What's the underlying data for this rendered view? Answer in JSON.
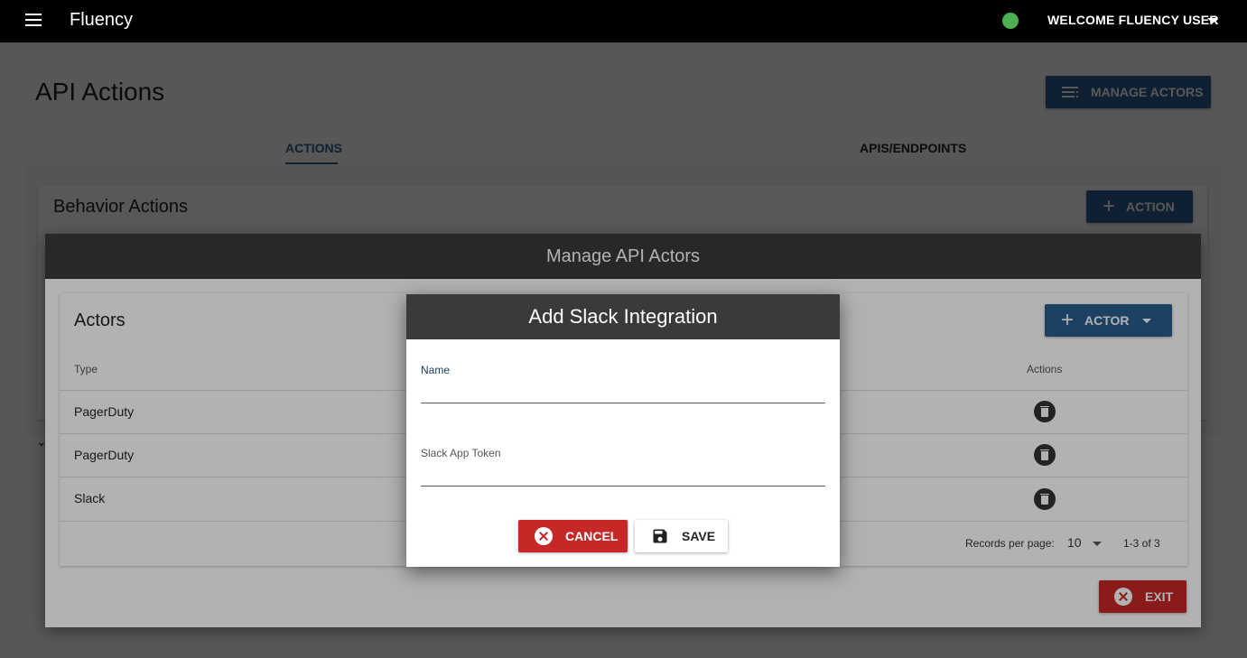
{
  "app": {
    "title": "Fluency",
    "user_menu": "WELCOME FLUENCY USER"
  },
  "icons": {
    "menu": "hamburger-icon",
    "status": "status-dot-icon",
    "manage_actors": "list-icon",
    "add": "plus-icon",
    "delete": "trash-icon",
    "cancel": "close-circle-icon",
    "save": "save-icon"
  },
  "colors": {
    "primary": "#2a5d8f",
    "danger": "#c62828",
    "status": "#4caf50",
    "header": "#3a3a3a"
  },
  "page": {
    "title": "API Actions",
    "manage_actors_label": "MANAGE ACTORS",
    "tabs": [
      {
        "label": "ACTIONS",
        "active": true
      },
      {
        "label": "APIS/ENDPOINTS",
        "active": false
      }
    ],
    "card_title": "Behavior Actions",
    "action_label": "ACTION"
  },
  "manage_dialog": {
    "title": "Manage API Actors",
    "card_title": "Actors",
    "actor_label": "ACTOR",
    "columns": {
      "type": "Type",
      "actions": "Actions"
    },
    "rows": [
      {
        "type": "PagerDuty"
      },
      {
        "type": "PagerDuty"
      },
      {
        "type": "Slack"
      }
    ],
    "records_per_page_label": "Records per page:",
    "records_per_page_value": "10",
    "range": "1-3 of 3",
    "exit_label": "EXIT"
  },
  "slack_dialog": {
    "title": "Add Slack Integration",
    "name_label": "Name",
    "name_value": "",
    "token_label": "Slack App Token",
    "token_value": "",
    "cancel_label": "CANCEL",
    "save_label": "SAVE"
  }
}
